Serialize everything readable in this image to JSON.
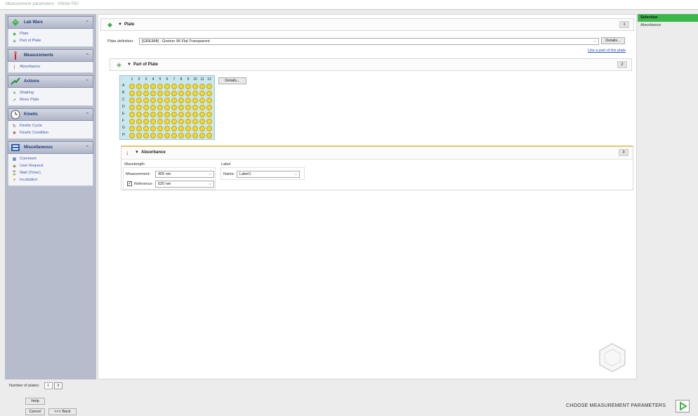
{
  "window": {
    "title": "Measurement parameters - Infinite F50"
  },
  "sidebar": {
    "groups": [
      {
        "label": "Lab Ware",
        "items": [
          {
            "label": "Plate"
          },
          {
            "label": "Part of Plate"
          }
        ]
      },
      {
        "label": "Measurements",
        "items": [
          {
            "label": "Absorbance"
          }
        ]
      },
      {
        "label": "Actions",
        "items": [
          {
            "label": "Shaking"
          },
          {
            "label": "Move Plate"
          }
        ]
      },
      {
        "label": "Kinetic",
        "items": [
          {
            "label": "Kinetic Cycle"
          },
          {
            "label": "Kinetic Condition"
          }
        ]
      },
      {
        "label": "Miscellaneous",
        "items": [
          {
            "label": "Comment"
          },
          {
            "label": "User Request"
          },
          {
            "label": "Wait (Timer)"
          },
          {
            "label": "Incubation"
          }
        ]
      }
    ]
  },
  "plate_section": {
    "title": "Plate",
    "number": "1",
    "definition_label": "Plate definition:",
    "definition_value": "[GRE96ft] - Greiner 96 Flat Transparent",
    "details_label": "Details...",
    "use_part_link": "Use a part of the plate"
  },
  "part_section": {
    "title": "Part of Plate",
    "number": "2",
    "details_label": "Details...",
    "columns": [
      "1",
      "2",
      "3",
      "4",
      "5",
      "6",
      "7",
      "8",
      "9",
      "10",
      "11",
      "12"
    ],
    "rows": [
      "A",
      "B",
      "C",
      "D",
      "E",
      "F",
      "G",
      "H"
    ]
  },
  "absorbance_section": {
    "title": "Absorbance",
    "number": "3",
    "wavelength_group": "Wavelength",
    "measurement_label": "Measurement:",
    "measurement_value": "405 nm",
    "reference_label": "Reference:",
    "reference_value": "620 nm",
    "reference_checked": true,
    "label_group": "Label",
    "name_label": "Name:",
    "name_value": "Label1"
  },
  "right_panel": {
    "header": "Selection",
    "items": [
      "Absorbance"
    ],
    "accent": "#3cb54a"
  },
  "footer": {
    "plates_label": "Number of plates:",
    "plates_value": "1",
    "help_label": "Help",
    "cancel_label": "Cancel",
    "back_label": "<<< Back",
    "status_text": "CHOOSE MEASUREMENT PARAMETERS"
  },
  "colors": {
    "well": "#f2d72c",
    "plate_bg": "#c9e7ef",
    "link": "#2a55c9"
  }
}
